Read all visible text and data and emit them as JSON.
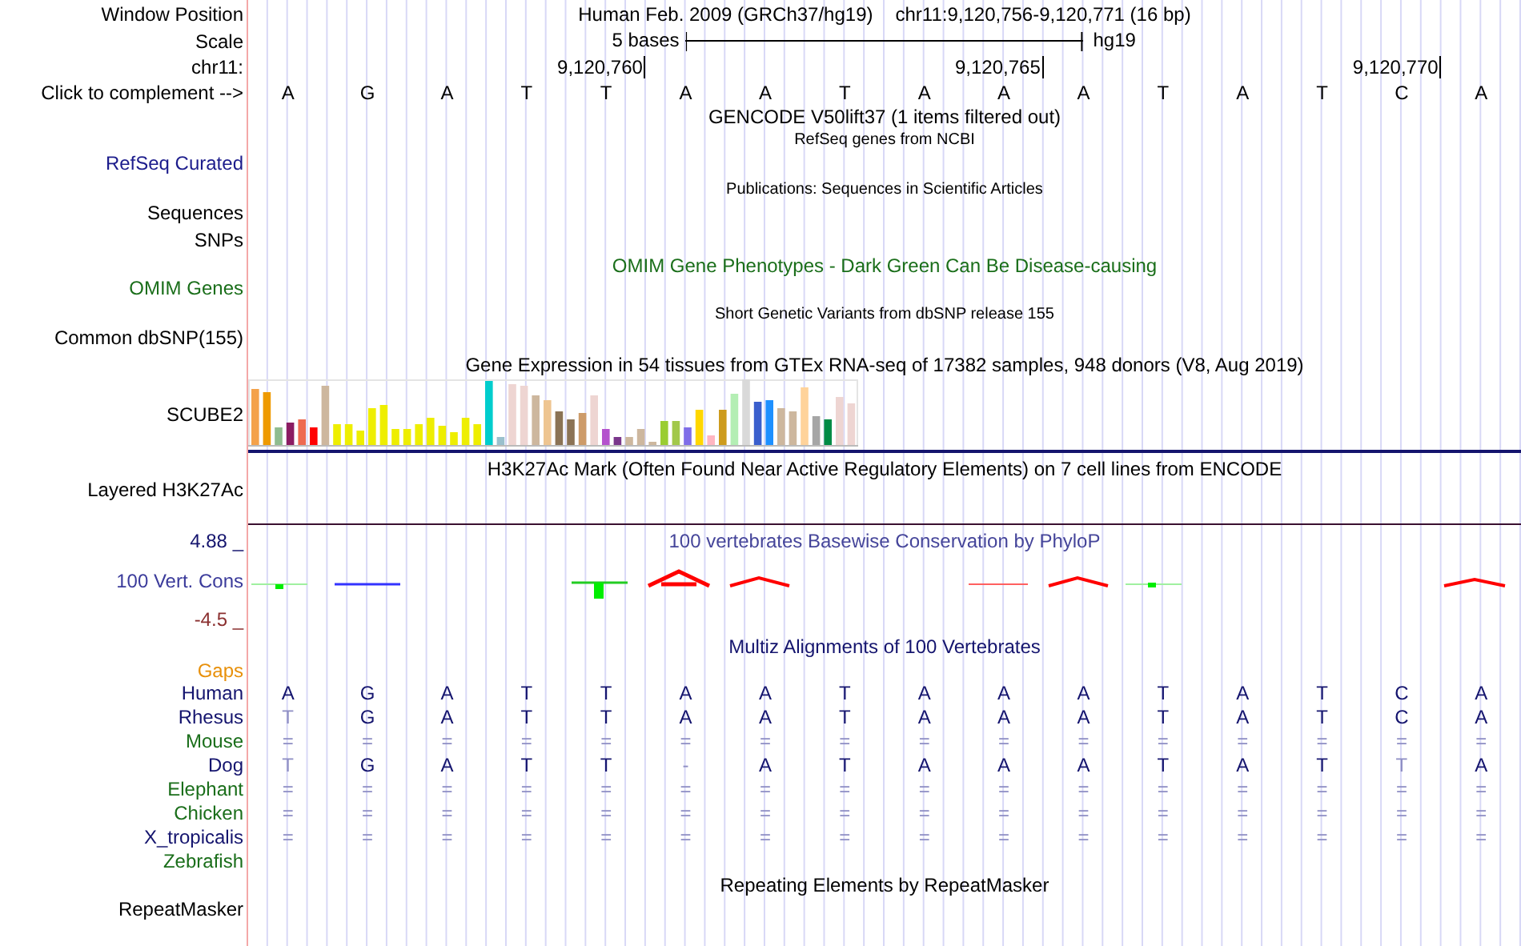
{
  "header": {
    "label": "Window Position",
    "assembly": "Human Feb. 2009 (GRCh37/hg19)",
    "position": "chr11:9,120,756-9,120,771 (16 bp)"
  },
  "scale": {
    "label": "Scale",
    "length": "5 bases",
    "assembly": "hg19"
  },
  "ruler": {
    "label": "chr11:",
    "ticks": [
      "9,120,760",
      "9,120,765",
      "9,120,770"
    ]
  },
  "sequence": {
    "label": "Click to complement -->",
    "bases": [
      "A",
      "G",
      "A",
      "T",
      "T",
      "A",
      "A",
      "T",
      "A",
      "A",
      "A",
      "T",
      "A",
      "T",
      "C",
      "A"
    ]
  },
  "tracks": [
    {
      "kind": "heading",
      "title": {
        "text": "GENCODE V50lift37 (1 items filtered out)",
        "color": "#000000"
      }
    },
    {
      "kind": "small",
      "title": {
        "text": "RefSeq genes from NCBI",
        "color": "#000000"
      },
      "label": {
        "text": "RefSeq Curated",
        "color": "#1c1c8c"
      }
    },
    {
      "kind": "small",
      "title": {
        "text": "Publications: Sequences in Scientific Articles",
        "color": "#000000"
      },
      "label": {
        "text": "Sequences",
        "color": "#000000"
      }
    },
    {
      "kind": "label_only",
      "label": {
        "text": "SNPs",
        "color": "#000000"
      }
    },
    {
      "kind": "large",
      "title": {
        "text": "OMIM Gene Phenotypes - Dark Green Can Be Disease-causing",
        "color": "#1a6e1a"
      },
      "label": {
        "text": "OMIM Genes",
        "color": "#1a6e1a"
      }
    },
    {
      "kind": "small",
      "title": {
        "text": "Short Genetic Variants from dbSNP release 155",
        "color": "#000000"
      },
      "label": {
        "text": "Common dbSNP(155)",
        "color": "#000000"
      }
    },
    {
      "kind": "expression",
      "title": {
        "text": "Gene Expression in 54 tissues from GTEx RNA-seq of 17382 samples, 948 donors (V8, Aug 2019)",
        "color": "#000000"
      },
      "label": {
        "text": "SCUBE2",
        "color": "#000000"
      }
    },
    {
      "kind": "mark",
      "title": {
        "text": "H3K27Ac Mark (Often Found Near Active Regulatory Elements) on 7 cell lines from ENCODE",
        "color": "#000000"
      },
      "label": {
        "text": "Layered H3K27Ac",
        "color": "#000000"
      }
    },
    {
      "kind": "conservation",
      "title": {
        "text": "100 vertebrates Basewise Conservation by PhyloP",
        "color": "#45459a"
      },
      "label": {
        "text": "100 Vert. Cons",
        "color": "#3b3b9b"
      },
      "max": "4.88 _",
      "min": "-4.5 _"
    },
    {
      "kind": "alignment",
      "title": {
        "text": "Multiz Alignments of 100 Vertebrates",
        "color": "#14146e"
      },
      "label": {
        "text": "Gaps",
        "color": "#e8900a"
      },
      "species": [
        {
          "name": "Human",
          "color": "#14146e",
          "bases": [
            "A",
            "G",
            "A",
            "T",
            "T",
            "A",
            "A",
            "T",
            "A",
            "A",
            "A",
            "T",
            "A",
            "T",
            "C",
            "A"
          ]
        },
        {
          "name": "Rhesus",
          "color": "#14146e",
          "bases": [
            "T",
            "G",
            "A",
            "T",
            "T",
            "A",
            "A",
            "T",
            "A",
            "A",
            "A",
            "T",
            "A",
            "T",
            "C",
            "A"
          ]
        },
        {
          "name": "Mouse",
          "color": "#1a6e1a",
          "bases": [
            "=",
            "=",
            "=",
            "=",
            "=",
            "=",
            "=",
            "=",
            "=",
            "=",
            "=",
            "=",
            "=",
            "=",
            "=",
            "="
          ]
        },
        {
          "name": "Dog",
          "color": "#14146e",
          "bases": [
            "T",
            "G",
            "A",
            "T",
            "T",
            "-",
            "A",
            "T",
            "A",
            "A",
            "A",
            "T",
            "A",
            "T",
            "T",
            "A"
          ]
        },
        {
          "name": "Elephant",
          "color": "#1a6e1a",
          "bases": [
            "=",
            "=",
            "=",
            "=",
            "=",
            "=",
            "=",
            "=",
            "=",
            "=",
            "=",
            "=",
            "=",
            "=",
            "=",
            "="
          ]
        },
        {
          "name": "Chicken",
          "color": "#1a6e1a",
          "bases": [
            "=",
            "=",
            "=",
            "=",
            "=",
            "=",
            "=",
            "=",
            "=",
            "=",
            "=",
            "=",
            "=",
            "=",
            "=",
            "="
          ]
        },
        {
          "name": "X_tropicalis",
          "color": "#14146e",
          "bases": [
            "=",
            "=",
            "=",
            "=",
            "=",
            "=",
            "=",
            "=",
            "=",
            "=",
            "=",
            "=",
            "=",
            "=",
            "=",
            "="
          ]
        },
        {
          "name": "Zebrafish",
          "color": "#1a6e1a"
        }
      ]
    },
    {
      "kind": "repeat",
      "title": {
        "text": "Repeating Elements by RepeatMasker",
        "color": "#000000"
      },
      "label": {
        "text": "RepeatMasker",
        "color": "#000000"
      }
    }
  ]
}
